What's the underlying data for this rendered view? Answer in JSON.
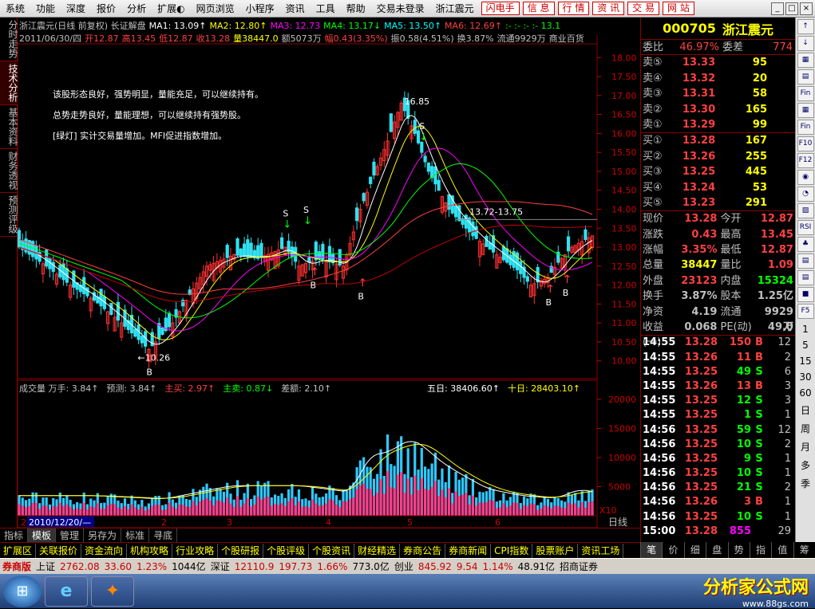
{
  "menu": {
    "items": [
      "系统",
      "功能",
      "深度",
      "报价",
      "分析",
      "扩展◐",
      "网页浏览",
      "小程序",
      "资讯",
      "工具",
      "帮助",
      "交易未登录",
      "浙江震元"
    ],
    "red_buttons": [
      "闪电手",
      "信 息",
      "行 情",
      "资 讯",
      "交 易",
      "网 站"
    ],
    "win_controls": [
      "_",
      "□",
      "×"
    ]
  },
  "vtabs": [
    {
      "label": "分时走势",
      "active": false
    },
    {
      "label": "技术分析",
      "active": true
    },
    {
      "label": "基本资料",
      "active": false
    },
    {
      "label": "财务透视",
      "active": false
    },
    {
      "label": "预测评级",
      "active": false
    }
  ],
  "header": {
    "line1": [
      {
        "t": "浙江震元(日线 前复权) 长证解盘",
        "c": "#c0c0c0"
      },
      {
        "t": "MA1: 13.09↑",
        "c": "#ffffff"
      },
      {
        "t": "MA2: 12.80↑",
        "c": "#ffff00"
      },
      {
        "t": "MA3: 12.73",
        "c": "#ff00ff"
      },
      {
        "t": "MA4: 13.17↓",
        "c": "#00ff00"
      },
      {
        "t": "MA5: 13.50↑",
        "c": "#00ffff"
      },
      {
        "t": "MA6: 12.69↑",
        "c": "#ff4040"
      },
      {
        "t": ":-  :-  :-  :- 13.1",
        "c": "#00ff00"
      }
    ],
    "line2": [
      {
        "t": "2011/06/30/四",
        "c": "#c0c0c0"
      },
      {
        "t": "开12.87",
        "c": "#ff4040"
      },
      {
        "t": "高13.45",
        "c": "#ff4040"
      },
      {
        "t": "低12.87",
        "c": "#ff4040"
      },
      {
        "t": "收13.28",
        "c": "#ff4040"
      },
      {
        "t": "量38447.0",
        "c": "#ffff00"
      },
      {
        "t": "额5073万",
        "c": "#c0c0c0"
      },
      {
        "t": "幅0.43(3.35%)",
        "c": "#ff4040"
      },
      {
        "t": "振0.58(4.51%)",
        "c": "#c0c0c0"
      },
      {
        "t": "换3.87%",
        "c": "#c0c0c0"
      },
      {
        "t": "流通9929万",
        "c": "#c0c0c0"
      },
      {
        "t": "商业百货",
        "c": "#c0c0c0"
      }
    ]
  },
  "commentary": [
    "该股形态良好，强势明显，量能充足，可以继续持有。",
    "总势走势良好，量能理想，可以继续持有强势股。",
    "[绿灯] 实计交易量增加。MFI促进指数增加。"
  ],
  "price_axis": {
    "ticks": [
      "18.00",
      "17.50",
      "17.00",
      "16.50",
      "16.00",
      "15.50",
      "15.00",
      "14.50",
      "14.00",
      "13.50",
      "13.00",
      "12.50",
      "12.00",
      "11.50",
      "11.00",
      "10.50",
      "10.00"
    ]
  },
  "annotations": {
    "high": "16.85",
    "low": "←10.26",
    "range": "13.72-13.75",
    "buy": "B",
    "sell": "S",
    "arrow_b": "↑",
    "arrow_s": "↓"
  },
  "vol_header": [
    {
      "t": "成交量  万手: 3.84↑",
      "c": "#c0c0c0"
    },
    {
      "t": "预测: 3.84↑",
      "c": "#c0c0c0"
    },
    {
      "t": "主买: 2.97↑",
      "c": "#ff4040"
    },
    {
      "t": "主卖: 0.87↓",
      "c": "#00ff00"
    },
    {
      "t": "差额: 2.10↑",
      "c": "#c0c0c0"
    },
    {
      "t": "五日: 38406.60↑",
      "c": "#ffffff"
    },
    {
      "t": "十日: 28403.10↑",
      "c": "#ffff00"
    }
  ],
  "vol_axis": {
    "ticks": [
      "20000",
      "15000",
      "10000",
      "5000"
    ],
    "unit": "X10"
  },
  "date_axis": {
    "labels": [
      "2",
      "2010/12/20/—",
      "2",
      "3",
      "4",
      "5",
      "6"
    ],
    "right": "日线"
  },
  "chart_data": {
    "type": "candlestick",
    "price_ylim": [
      9.7,
      18.3
    ],
    "volume_ylim": [
      0,
      21500
    ],
    "price_ticks": [
      18,
      17.5,
      17,
      16.5,
      16,
      15.5,
      15,
      14.5,
      14,
      13.5,
      13,
      12.5,
      12,
      11.5,
      11,
      10.5,
      10
    ],
    "vol_ticks": [
      20000,
      15000,
      10000,
      5000
    ],
    "close_path": [
      [
        0,
        13.0
      ],
      [
        8,
        12.5
      ],
      [
        15,
        12.0
      ],
      [
        22,
        11.6
      ],
      [
        30,
        11.0
      ],
      [
        38,
        10.3
      ],
      [
        45,
        11.0
      ],
      [
        55,
        12.5
      ],
      [
        63,
        12.8
      ],
      [
        70,
        12.7
      ],
      [
        78,
        13.0
      ],
      [
        82,
        12.5
      ],
      [
        88,
        12.7
      ],
      [
        95,
        12.5
      ],
      [
        100,
        14.0
      ],
      [
        108,
        15.8
      ],
      [
        112,
        16.8
      ],
      [
        116,
        16.0
      ],
      [
        120,
        15.0
      ],
      [
        126,
        14.0
      ],
      [
        133,
        13.3
      ],
      [
        140,
        12.8
      ],
      [
        146,
        12.4
      ],
      [
        150,
        12.0
      ],
      [
        155,
        12.2
      ],
      [
        158,
        12.6
      ],
      [
        162,
        13.0
      ],
      [
        168,
        13.3
      ]
    ],
    "vol_path": [
      [
        0,
        3000
      ],
      [
        20,
        3000
      ],
      [
        40,
        2500
      ],
      [
        60,
        4500
      ],
      [
        80,
        4500
      ],
      [
        95,
        3500
      ],
      [
        100,
        9000
      ],
      [
        106,
        9500
      ],
      [
        112,
        11500
      ],
      [
        116,
        10500
      ],
      [
        120,
        8500
      ],
      [
        126,
        6500
      ],
      [
        135,
        4000
      ],
      [
        145,
        3000
      ],
      [
        155,
        2600
      ],
      [
        162,
        4000
      ],
      [
        168,
        3300
      ]
    ],
    "x_count": 169
  },
  "quote": {
    "code": "000705",
    "name": "浙江震元",
    "weibi": {
      "label": "委比",
      "value": "46.97%",
      "label2": "委差",
      "value2": "774"
    },
    "sell": [
      {
        "l": "卖⑤",
        "p": "13.33",
        "v": "95"
      },
      {
        "l": "卖④",
        "p": "13.32",
        "v": "20"
      },
      {
        "l": "卖③",
        "p": "13.31",
        "v": "58"
      },
      {
        "l": "卖②",
        "p": "13.30",
        "v": "165"
      },
      {
        "l": "卖①",
        "p": "13.29",
        "v": "99"
      }
    ],
    "buy": [
      {
        "l": "买①",
        "p": "13.28",
        "v": "167"
      },
      {
        "l": "买②",
        "p": "13.26",
        "v": "255"
      },
      {
        "l": "买③",
        "p": "13.25",
        "v": "445"
      },
      {
        "l": "买④",
        "p": "13.24",
        "v": "53"
      },
      {
        "l": "买⑤",
        "p": "13.23",
        "v": "291"
      }
    ],
    "stats": [
      {
        "a": "现价",
        "av": "13.28",
        "ac": "#ff4040",
        "b": "今开",
        "bv": "12.87",
        "bc": "#ff4040"
      },
      {
        "a": "涨跌",
        "av": "0.43",
        "ac": "#ff4040",
        "b": "最高",
        "bv": "13.45",
        "bc": "#ff4040"
      },
      {
        "a": "涨幅",
        "av": "3.35%",
        "ac": "#ff4040",
        "b": "最低",
        "bv": "12.87",
        "bc": "#ff4040"
      },
      {
        "a": "总量",
        "av": "38447",
        "ac": "#ffff00",
        "b": "量比",
        "bv": "1.09",
        "bc": "#ff4040"
      },
      {
        "a": "外盘",
        "av": "23123",
        "ac": "#ff4040",
        "b": "内盘",
        "bv": "15324",
        "bc": "#00ff00"
      },
      {
        "a": "换手",
        "av": "3.87%",
        "ac": "#c0c0c0",
        "b": "股本",
        "bv": "1.25亿",
        "bc": "#c0c0c0"
      },
      {
        "a": "净资",
        "av": "4.19",
        "ac": "#c0c0c0",
        "b": "流通",
        "bv": "9929万",
        "bc": "#c0c0c0"
      },
      {
        "a": "收益(一)",
        "av": "0.068",
        "ac": "#c0c0c0",
        "b": "PE(动)",
        "bv": "49.0",
        "bc": "#c0c0c0"
      }
    ],
    "ticks": [
      {
        "t": "14:55",
        "p": "13.28",
        "v": "150",
        "s": "B",
        "n": "12"
      },
      {
        "t": "14:55",
        "p": "13.26",
        "v": "11",
        "s": "B",
        "n": "2"
      },
      {
        "t": "14:55",
        "p": "13.25",
        "v": "49",
        "s": "S",
        "n": "6"
      },
      {
        "t": "14:55",
        "p": "13.26",
        "v": "13",
        "s": "B",
        "n": "3"
      },
      {
        "t": "14:55",
        "p": "13.25",
        "v": "12",
        "s": "S",
        "n": "3"
      },
      {
        "t": "14:55",
        "p": "13.25",
        "v": "1",
        "s": "S",
        "n": "1"
      },
      {
        "t": "14:56",
        "p": "13.25",
        "v": "59",
        "s": "S",
        "n": "12"
      },
      {
        "t": "14:56",
        "p": "13.25",
        "v": "10",
        "s": "S",
        "n": "2"
      },
      {
        "t": "14:56",
        "p": "13.25",
        "v": "9",
        "s": "S",
        "n": "1"
      },
      {
        "t": "14:56",
        "p": "13.25",
        "v": "10",
        "s": "S",
        "n": "1"
      },
      {
        "t": "14:56",
        "p": "13.25",
        "v": "21",
        "s": "S",
        "n": "2"
      },
      {
        "t": "14:56",
        "p": "13.26",
        "v": "3",
        "s": "B",
        "n": "1"
      },
      {
        "t": "14:56",
        "p": "13.25",
        "v": "10",
        "s": "S",
        "n": "1"
      },
      {
        "t": "15:00",
        "p": "13.28",
        "v": "855",
        "s": "",
        "n": "29"
      }
    ]
  },
  "right_toolbar": [
    "↑",
    "↓",
    "▦",
    "▤",
    "Fin",
    "▦",
    "Fin",
    "F10",
    "F12",
    "◉",
    "◔",
    "▨",
    "RSI",
    "♣",
    "▤",
    "▤",
    "■",
    "F5",
    "1",
    "5",
    "15",
    "30",
    "60",
    "日",
    "周",
    "月",
    "多",
    "季"
  ],
  "bottom_tabs1": [
    {
      "l": "指标",
      "on": false
    },
    {
      "l": "模板",
      "on": true
    },
    {
      "l": "管理",
      "on": false
    },
    {
      "l": "另存为",
      "on": false
    },
    {
      "l": "标准",
      "on": false
    },
    {
      "l": "寻底",
      "on": false
    }
  ],
  "bottom_tabs2": [
    "扩展区",
    "关联报价",
    "资金流向",
    "机构攻略",
    "行业攻略",
    "个股研报",
    "个股评级",
    "个股资讯",
    "财经精选",
    "券商公告",
    "券商新闻",
    "CPI指数",
    "股票账户",
    "资讯工场"
  ],
  "quote_tabs": [
    {
      "l": "笔",
      "on": true
    },
    {
      "l": "价",
      "on": false
    },
    {
      "l": "细",
      "on": false
    },
    {
      "l": "盘",
      "on": false
    },
    {
      "l": "势",
      "on": false
    },
    {
      "l": "指",
      "on": false
    },
    {
      "l": "值",
      "on": false
    },
    {
      "l": "筹",
      "on": false
    }
  ],
  "status": [
    {
      "t": "券商版",
      "c": "#c00"
    },
    {
      "t": "上证",
      "c": "#000"
    },
    {
      "t": "2762.08",
      "c": "#c00"
    },
    {
      "t": "33.60",
      "c": "#c00"
    },
    {
      "t": "1.23%",
      "c": "#c00"
    },
    {
      "t": "1044亿",
      "c": "#000"
    },
    {
      "t": "深证",
      "c": "#000"
    },
    {
      "t": "12110.9",
      "c": "#c00"
    },
    {
      "t": "197.73",
      "c": "#c00"
    },
    {
      "t": "1.66%",
      "c": "#c00"
    },
    {
      "t": "773.0亿",
      "c": "#000"
    },
    {
      "t": "创业",
      "c": "#000"
    },
    {
      "t": "845.92",
      "c": "#c00"
    },
    {
      "t": "9.54",
      "c": "#c00"
    },
    {
      "t": "1.14%",
      "c": "#c00"
    },
    {
      "t": "48.91亿",
      "c": "#000"
    },
    {
      "t": "招商证券",
      "c": "#000"
    }
  ],
  "taskbar": {
    "start": "⊞",
    "ie": "e",
    "app": "✦"
  },
  "brand": {
    "line1": "分析家公式网",
    "line2": "www.88gs.com"
  }
}
